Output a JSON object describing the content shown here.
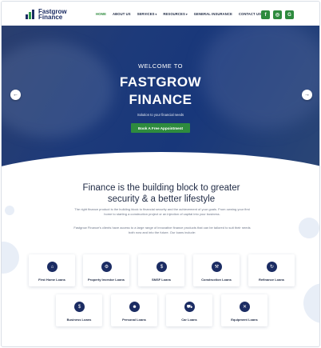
{
  "brand": {
    "name_line1": "Fastgrow",
    "name_line2": "Finance"
  },
  "nav": {
    "items": [
      {
        "label": "HOME",
        "active": true
      },
      {
        "label": "ABOUT US"
      },
      {
        "label": "SERVICES",
        "caret": "▾"
      },
      {
        "label": "RESOURCES",
        "caret": "▾"
      },
      {
        "label": "GENERAL INSURANCE"
      },
      {
        "label": "CONTACT US"
      }
    ]
  },
  "social": [
    {
      "icon": "facebook-icon",
      "glyph": "f"
    },
    {
      "icon": "instagram-icon",
      "glyph": "◎"
    },
    {
      "icon": "google-icon",
      "glyph": "G"
    }
  ],
  "hero": {
    "welcome": "WELCOME TO",
    "title_line1": "FASTGROW",
    "title_line2": "FINANCE",
    "subtitle": "Solution to your financial needs",
    "cta": "Book A Free Appointment",
    "prev": "←",
    "next": "→"
  },
  "intro": {
    "title_line1": "Finance is the building block to greater",
    "title_line2": "security & a better lifestyle",
    "p1": "The right finance product is the building block to financial security and the achievement of your goals. From owning your first home to starting a construction project or an injection of capital into your business.",
    "p2": "Fastgrow Finance's clients have access to a large range of innovative finance products that can be tailored to suit their needs both now and into the future. Our loans include:"
  },
  "loans": [
    {
      "label": "First Home Loans",
      "icon": "bank-icon",
      "glyph": "⌂"
    },
    {
      "label": "Property Investor Loans",
      "icon": "house-gear-icon",
      "glyph": "⚙"
    },
    {
      "label": "SMSF Loans",
      "icon": "money-hand-icon",
      "glyph": "$"
    },
    {
      "label": "Construction Loans",
      "icon": "hammer-icon",
      "glyph": "⚒"
    },
    {
      "label": "Refinance Loans",
      "icon": "refresh-icon",
      "glyph": "↻"
    },
    {
      "label": "Business Loans",
      "icon": "briefcase-money-icon",
      "glyph": "$"
    },
    {
      "label": "Personal Loans",
      "icon": "person-icon",
      "glyph": "☻"
    },
    {
      "label": "Car Loans",
      "icon": "car-icon",
      "glyph": "⛟"
    },
    {
      "label": "Equipment Loans",
      "icon": "tools-icon",
      "glyph": "✕"
    }
  ],
  "colors": {
    "brand_navy": "#1b2c63",
    "accent_green": "#2e8b3e"
  }
}
